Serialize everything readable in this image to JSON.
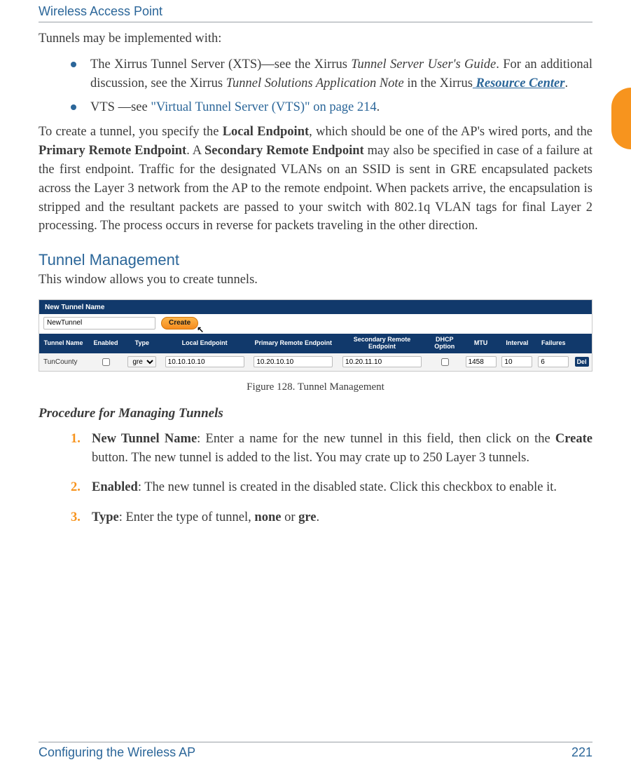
{
  "header": {
    "title": "Wireless Access Point"
  },
  "intro": "Tunnels may be implemented with:",
  "bullets": {
    "b1_pre": "The Xirrus Tunnel Server (XTS)—see the Xirrus ",
    "b1_em1": "Tunnel Server User's Guide",
    "b1_mid": ". For an additional discussion, see the Xirrus ",
    "b1_em2": "Tunnel Solutions Application Note",
    "b1_post1": " in the Xirrus",
    "b1_link": " Resource Center",
    "b1_end": ".",
    "b2_pre": "VTS —see ",
    "b2_xref": "\"Virtual Tunnel Server (VTS)\" on page 214",
    "b2_end": "."
  },
  "para": {
    "p1_a": "To create a tunnel, you specify the ",
    "p1_b": "Local Endpoint",
    "p1_c": ", which should be one of the AP's wired ports, and the ",
    "p1_d": "Primary Remote Endpoint",
    "p1_e": ". A ",
    "p1_f": "Secondary Remote Endpoint",
    "p1_g": " may also be specified in case of a failure at the first endpoint. Traffic for the designated VLANs on an SSID is sent in GRE encapsulated packets across the Layer 3 network from the AP to the remote endpoint. When packets arrive, the encapsulation is stripped and the resultant packets are passed to your switch with 802.1q VLAN tags for final Layer 2 processing. The process occurs in reverse for packets traveling in the other direction."
  },
  "section": {
    "title": "Tunnel Management",
    "sub": "This window allows you to create tunnels."
  },
  "figure": {
    "new_tunnel_label": "New Tunnel Name",
    "new_tunnel_value": "NewTunnel",
    "create_label": "Create",
    "headers": {
      "name": "Tunnel Name",
      "enabled": "Enabled",
      "type": "Type",
      "local": "Local Endpoint",
      "primary": "Primary Remote Endpoint",
      "secondary": "Secondary Remote Endpoint",
      "dhcp": "DHCP Option",
      "mtu": "MTU",
      "interval": "Interval",
      "failures": "Failures"
    },
    "row": {
      "name": "TunCounty",
      "type": "gre",
      "local": "10.10.10.10",
      "primary": "10.20.10.10",
      "secondary": "10.20.11.10",
      "mtu": "1458",
      "interval": "10",
      "failures": "6",
      "del": "Del"
    },
    "caption": "Figure 128. Tunnel Management"
  },
  "procedure": {
    "title": "Procedure for Managing Tunnels",
    "s1_num": "1.",
    "s1_b": "New Tunnel Name",
    "s1_a": ": Enter a name for the new tunnel in this field, then click on the ",
    "s1_b2": "Create",
    "s1_c": " button. The new tunnel is added to the list. You may crate up to 250 Layer 3 tunnels.",
    "s2_num": "2.",
    "s2_b": "Enabled",
    "s2_a": ": The new tunnel is created in the disabled state. Click this checkbox to enable it.",
    "s3_num": "3.",
    "s3_b": "Type",
    "s3_a": ": Enter the type of tunnel, ",
    "s3_b2": "none",
    "s3_mid": " or ",
    "s3_b3": "gre",
    "s3_end": "."
  },
  "footer": {
    "left": "Configuring the Wireless AP",
    "right": "221"
  }
}
